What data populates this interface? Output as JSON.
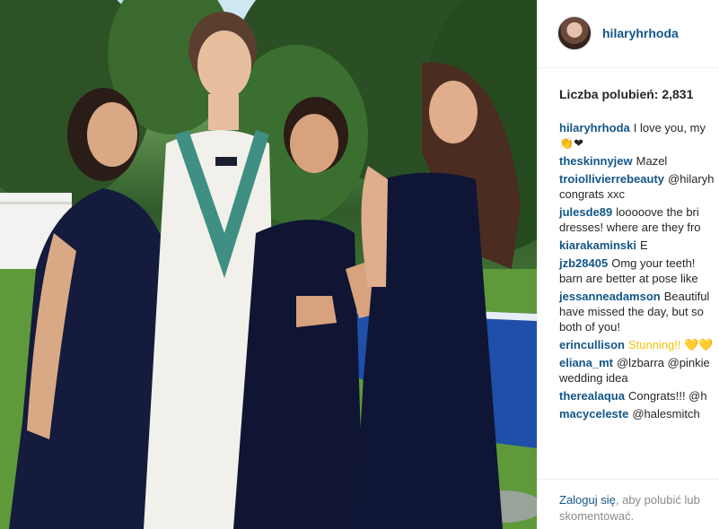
{
  "post": {
    "username": "hilaryhrhoda",
    "likes_text": "Liczba polubień: 2,831",
    "comments": [
      {
        "user": "hilaryhrhoda",
        "lines": [
          "I love you, my",
          "👏❤"
        ]
      },
      {
        "user": "theskinnyjew",
        "lines": [
          "Mazel"
        ]
      },
      {
        "user": "troiollivierrebeauty",
        "lines": [
          "@hilaryh",
          "congrats xxc"
        ]
      },
      {
        "user": "julesde89",
        "lines": [
          "looooove the bri",
          "dresses! where are they fro"
        ]
      },
      {
        "user": "kiarakaminski",
        "lines": [
          "E"
        ]
      },
      {
        "user": "jzb28405",
        "lines": [
          "Omg your teeth!",
          "barn are better at pose like"
        ]
      },
      {
        "user": "jessanneadamson",
        "lines": [
          "Beautiful",
          "have missed the day, but so",
          "both of you!"
        ]
      },
      {
        "user": "erincullison",
        "lines": [
          "Stunning!! 💛💛"
        ]
      },
      {
        "user": "eliana_mt",
        "lines": [
          "@lzbarra @pinkie",
          "wedding idea"
        ]
      },
      {
        "user": "therealaqua",
        "lines": [
          "Congrats!!! @h"
        ]
      },
      {
        "user": "macyceleste",
        "lines": [
          "@halesmitch"
        ]
      }
    ],
    "login": {
      "link_text": "Zaloguj się",
      "rest_line1": ", aby polubić lub",
      "rest_line2": "skomentować."
    }
  },
  "icons": {
    "avatar": "profile-avatar"
  },
  "colors": {
    "username_blue": "#125688",
    "text": "#262626",
    "muted": "#8a8a8a",
    "border": "#efefef"
  }
}
